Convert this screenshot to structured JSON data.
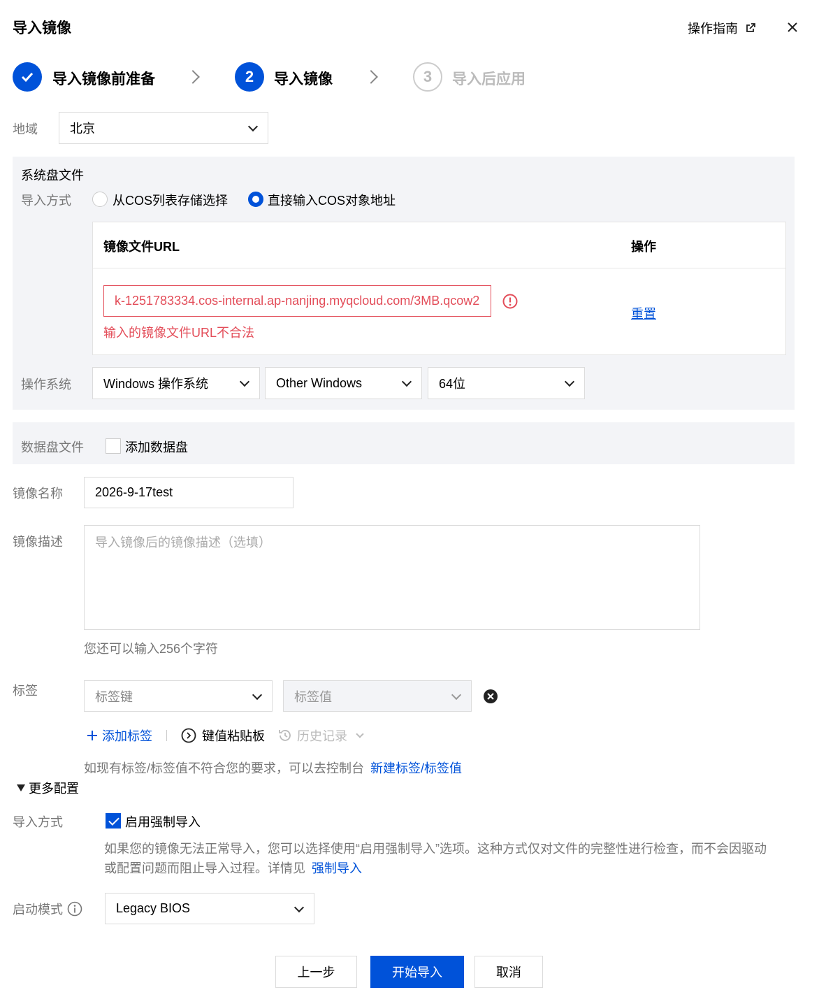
{
  "header": {
    "title": "导入镜像",
    "guide_label": "操作指南"
  },
  "steps": [
    {
      "label": "导入镜像前准备",
      "state": "done"
    },
    {
      "number": "2",
      "label": "导入镜像",
      "state": "active"
    },
    {
      "number": "3",
      "label": "导入后应用",
      "state": "pending"
    }
  ],
  "region": {
    "label": "地域",
    "value": "北京"
  },
  "system_disk": {
    "title": "系统盘文件",
    "import_method_label": "导入方式",
    "option_cos_list": "从COS列表存储选择",
    "option_direct": "直接输入COS对象地址",
    "table": {
      "col_url": "镜像文件URL",
      "col_action": "操作",
      "url_value": "k-1251783334.cos-internal.ap-nanjing.myqcloud.com/3MB.qcow2",
      "error_text": "输入的镜像文件URL不合法",
      "reset_label": "重置"
    },
    "os_label": "操作系统",
    "os_type": "Windows 操作系统",
    "os_version": "Other Windows",
    "os_bits": "64位"
  },
  "data_disk": {
    "title": "数据盘文件",
    "add_label": "添加数据盘"
  },
  "image_name": {
    "label": "镜像名称",
    "value": "2026-9-17test"
  },
  "image_desc": {
    "label": "镜像描述",
    "placeholder": "导入镜像后的镜像描述（选填）",
    "hint": "您还可以输入256个字符"
  },
  "tags": {
    "label": "标签",
    "key_placeholder": "标签键",
    "value_placeholder": "标签值",
    "add_label": "添加标签",
    "paste_label": "键值粘贴板",
    "history_label": "历史记录",
    "hint_prefix": "如现有标签/标签值不符合您的要求，可以去控制台",
    "hint_link": "新建标签/标签值"
  },
  "more_config": {
    "title": "更多配置",
    "import_method_label": "导入方式",
    "force_import_label": "启用强制导入",
    "force_desc_line1": "如果您的镜像无法正常导入，您可以选择使用“启用强制导入”选项。这种方式仅对文件的完整性进行检查，而不会因驱动",
    "force_desc_line2": "或配置问题而阻止导入过程。详情见",
    "force_desc_link": "强制导入",
    "boot_mode_label": "启动模式",
    "boot_mode_value": "Legacy BIOS"
  },
  "footer": {
    "prev_label": "上一步",
    "start_label": "开始导入",
    "cancel_label": "取消"
  },
  "colors": {
    "primary": "#0052d9",
    "error": "#e34d59",
    "panel_bg": "#f3f4f7"
  }
}
